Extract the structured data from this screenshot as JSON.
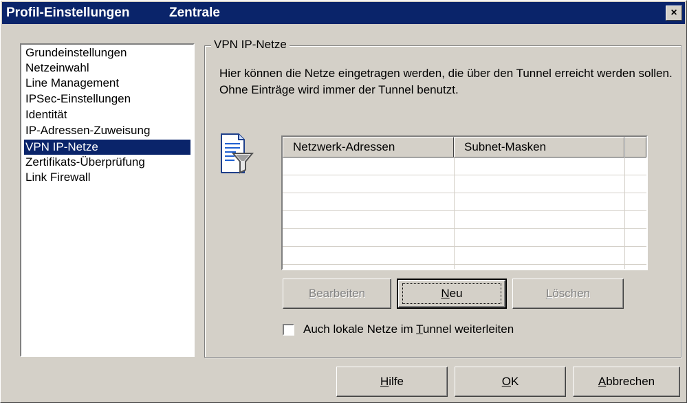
{
  "window": {
    "title": "Profil-Einstellungen",
    "subtitle": "Zentrale",
    "close_label": "×"
  },
  "sidebar": {
    "items": [
      {
        "label": "Grundeinstellungen"
      },
      {
        "label": "Netzeinwahl"
      },
      {
        "label": "Line Management"
      },
      {
        "label": "IPSec-Einstellungen"
      },
      {
        "label": "Identität"
      },
      {
        "label": "IP-Adressen-Zuweisung"
      },
      {
        "label": "VPN IP-Netze",
        "selected": true
      },
      {
        "label": "Zertifikats-Überprüfung"
      },
      {
        "label": "Link Firewall"
      }
    ]
  },
  "panel": {
    "group_title": "VPN IP-Netze",
    "description": "Hier können die Netze eingetragen werden, die über den Tunnel erreicht werden sollen. Ohne Einträge wird immer der Tunnel benutzt.",
    "icon": "filter-document-icon"
  },
  "table": {
    "columns": [
      "Netzwerk-Adressen",
      "Subnet-Masken"
    ],
    "rows": []
  },
  "buttons": {
    "edit": {
      "pre": "",
      "key": "B",
      "post": "earbeiten",
      "enabled": false
    },
    "new": {
      "pre": "",
      "key": "N",
      "post": "eu",
      "enabled": true
    },
    "delete": {
      "pre": "",
      "key": "L",
      "post": "öschen",
      "enabled": false
    }
  },
  "checkbox": {
    "pre": "Auch lokale Netze im ",
    "key": "T",
    "post": "unnel weiterleiten",
    "checked": false
  },
  "footer": {
    "help": {
      "key": "H",
      "post": "ilfe"
    },
    "ok": {
      "key": "O",
      "post": "K"
    },
    "cancel": {
      "key": "A",
      "post": "bbrechen"
    }
  },
  "colors": {
    "titlebar": "#0a246a",
    "selection": "#0a246a",
    "face": "#d4d0c8"
  }
}
